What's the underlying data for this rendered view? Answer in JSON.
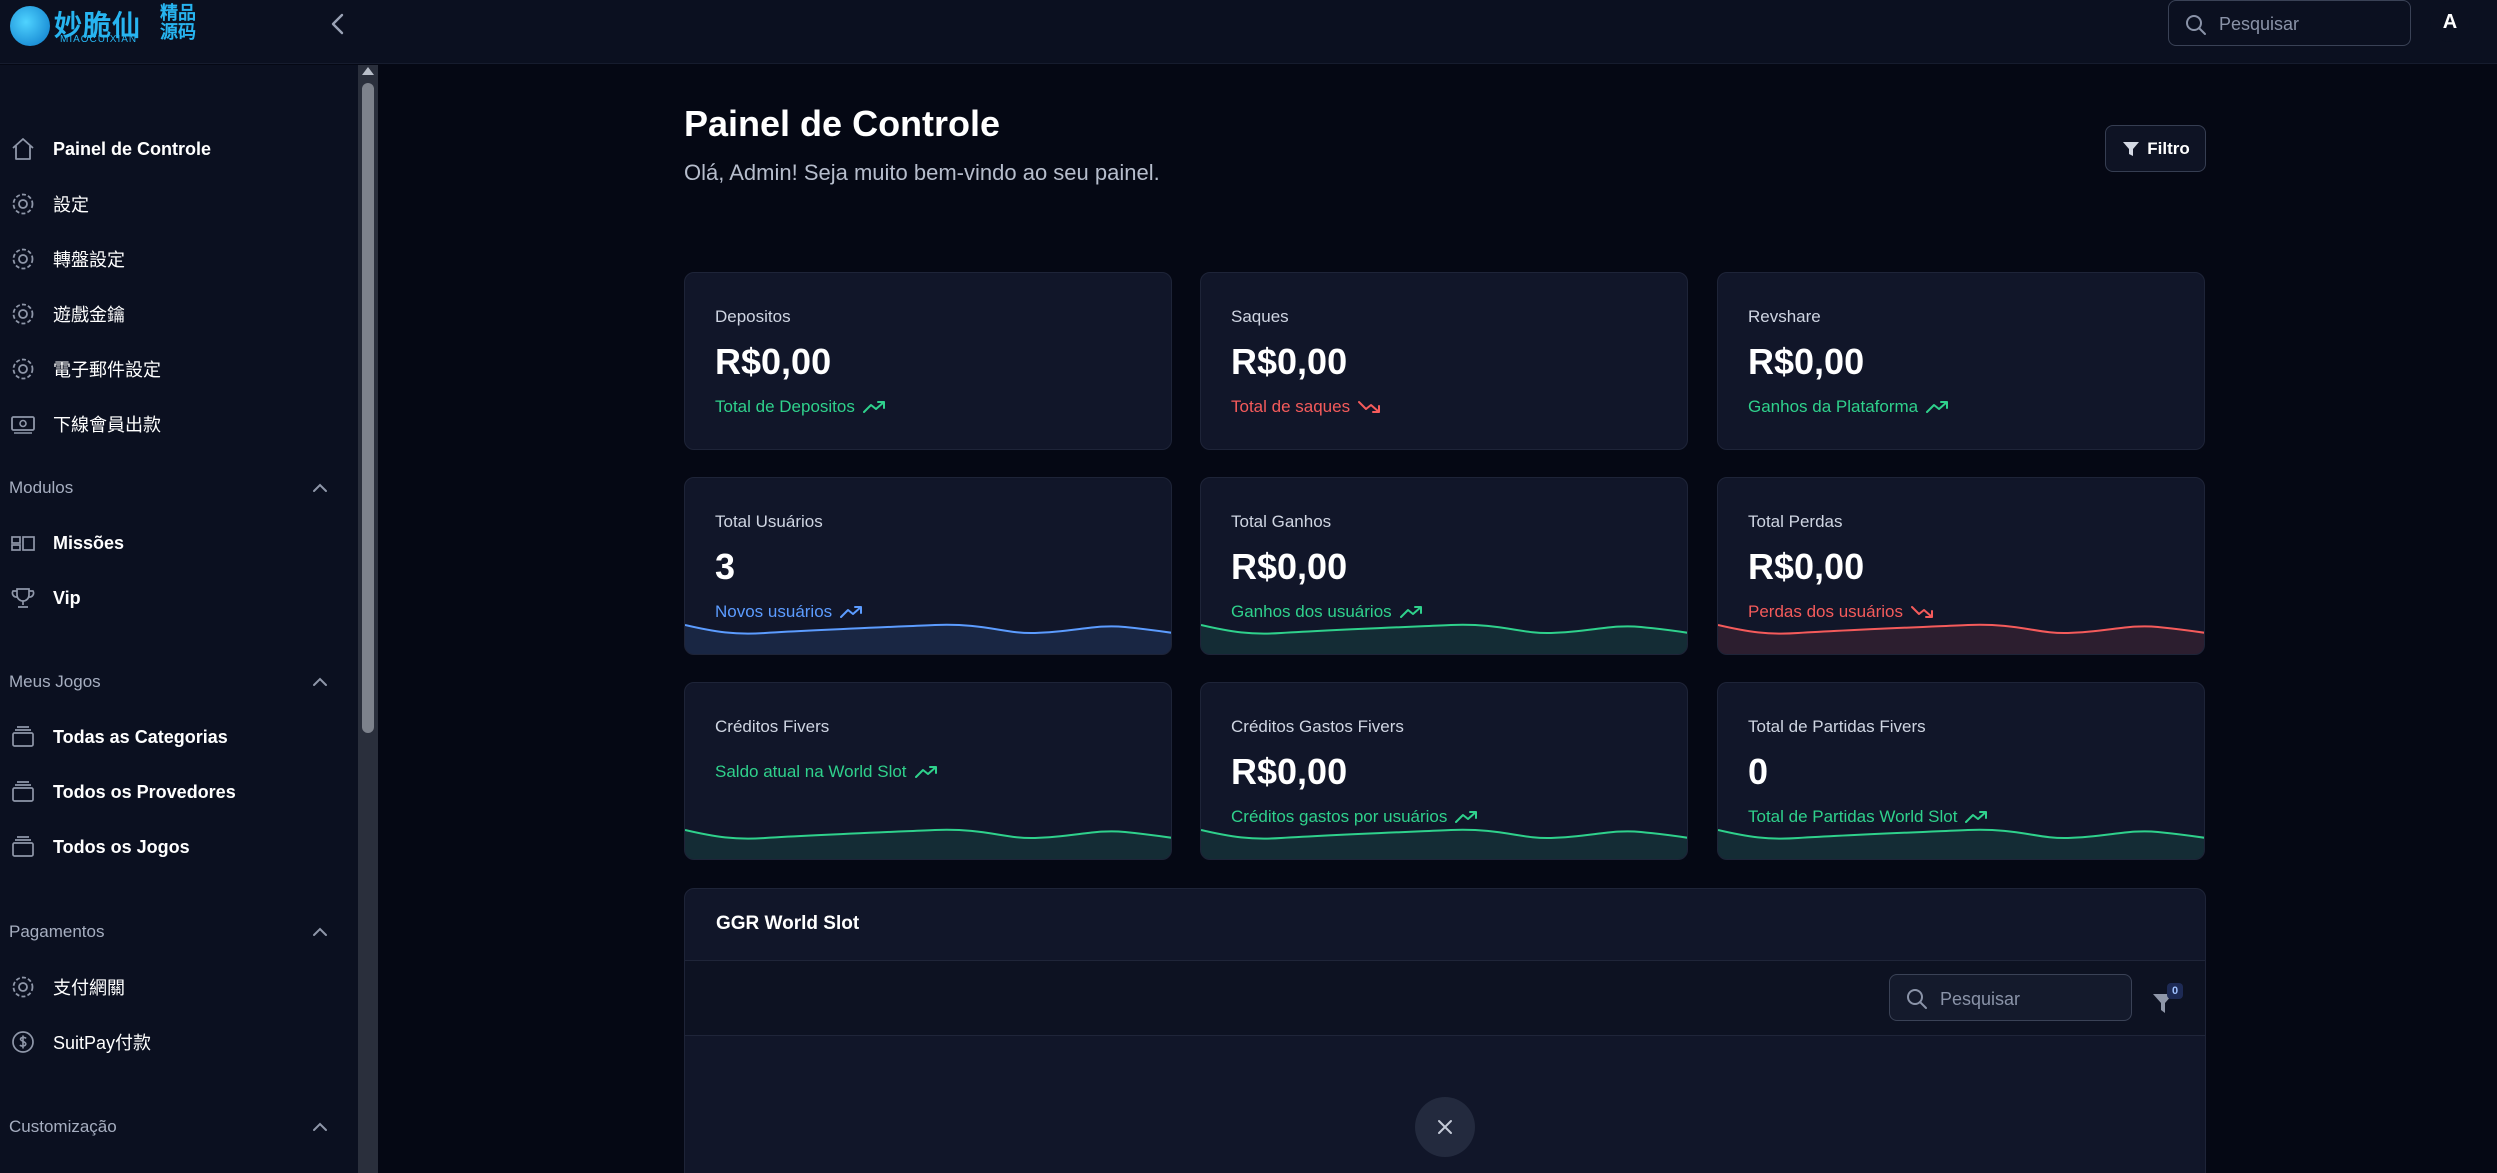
{
  "brand": {
    "name_cn": "妙脆仙",
    "name_en": "MIAOCUIXIAN",
    "tag": "精品源码"
  },
  "header": {
    "search_placeholder": "Pesquisar",
    "avatar_initial": "A"
  },
  "sidebar": {
    "items": [
      {
        "label": "Painel de Controle",
        "icon": "home-icon"
      },
      {
        "label": "設定",
        "icon": "gear-icon"
      },
      {
        "label": "轉盤設定",
        "icon": "gear-icon"
      },
      {
        "label": "遊戲金鑰",
        "icon": "gear-icon"
      },
      {
        "label": "電子郵件設定",
        "icon": "gear-icon"
      },
      {
        "label": "下線會員出款",
        "icon": "cash-icon"
      }
    ],
    "groups": {
      "modulos": {
        "label": "Modulos",
        "items": [
          {
            "label": "Missões",
            "icon": "missions-icon"
          },
          {
            "label": "Vip",
            "icon": "trophy-icon"
          }
        ]
      },
      "meus_jogos": {
        "label": "Meus Jogos",
        "items": [
          {
            "label": "Todas as Categorias",
            "icon": "folder-icon"
          },
          {
            "label": "Todos os Provedores",
            "icon": "folder-icon"
          },
          {
            "label": "Todos os Jogos",
            "icon": "folder-icon"
          }
        ]
      },
      "pagamentos": {
        "label": "Pagamentos",
        "items": [
          {
            "label": "支付網關",
            "icon": "gear-icon"
          },
          {
            "label": "SuitPay付款",
            "icon": "dollar-icon"
          }
        ]
      },
      "customizacao": {
        "label": "Customização"
      }
    }
  },
  "main": {
    "title": "Painel de Controle",
    "subtitle": "Olá, Admin! Seja muito bem-vindo ao seu painel.",
    "filter_label": "Filtro",
    "cards": [
      {
        "label": "Depositos",
        "value": "R$0,00",
        "desc": "Total de Depositos",
        "trend": "up",
        "color": "#2fd18c"
      },
      {
        "label": "Saques",
        "value": "R$0,00",
        "desc": "Total de saques",
        "trend": "down",
        "color": "#f55b5b"
      },
      {
        "label": "Revshare",
        "value": "R$0,00",
        "desc": "Ganhos da Plataforma",
        "trend": "up",
        "color": "#2fd18c"
      },
      {
        "label": "Total Usuários",
        "value": "3",
        "desc": "Novos usuários",
        "trend": "up",
        "color": "#5c9cff"
      },
      {
        "label": "Total Ganhos",
        "value": "R$0,00",
        "desc": "Ganhos dos usuários",
        "trend": "up",
        "color": "#2fd18c"
      },
      {
        "label": "Total Perdas",
        "value": "R$0,00",
        "desc": "Perdas dos usuários",
        "trend": "down",
        "color": "#f55b5b"
      },
      {
        "label": "Créditos Fivers",
        "value": "",
        "desc": "Saldo atual na World Slot",
        "trend": "up",
        "color": "#2fd18c"
      },
      {
        "label": "Créditos Gastos Fivers",
        "value": "R$0,00",
        "desc": "Créditos gastos por usuários",
        "trend": "up",
        "color": "#2fd18c"
      },
      {
        "label": "Total de Partidas Fivers",
        "value": "0",
        "desc": "Total de Partidas World Slot",
        "trend": "up",
        "color": "#2fd18c"
      }
    ],
    "table": {
      "title": "GGR World Slot",
      "search_placeholder": "Pesquisar",
      "filter_count": "0"
    }
  }
}
